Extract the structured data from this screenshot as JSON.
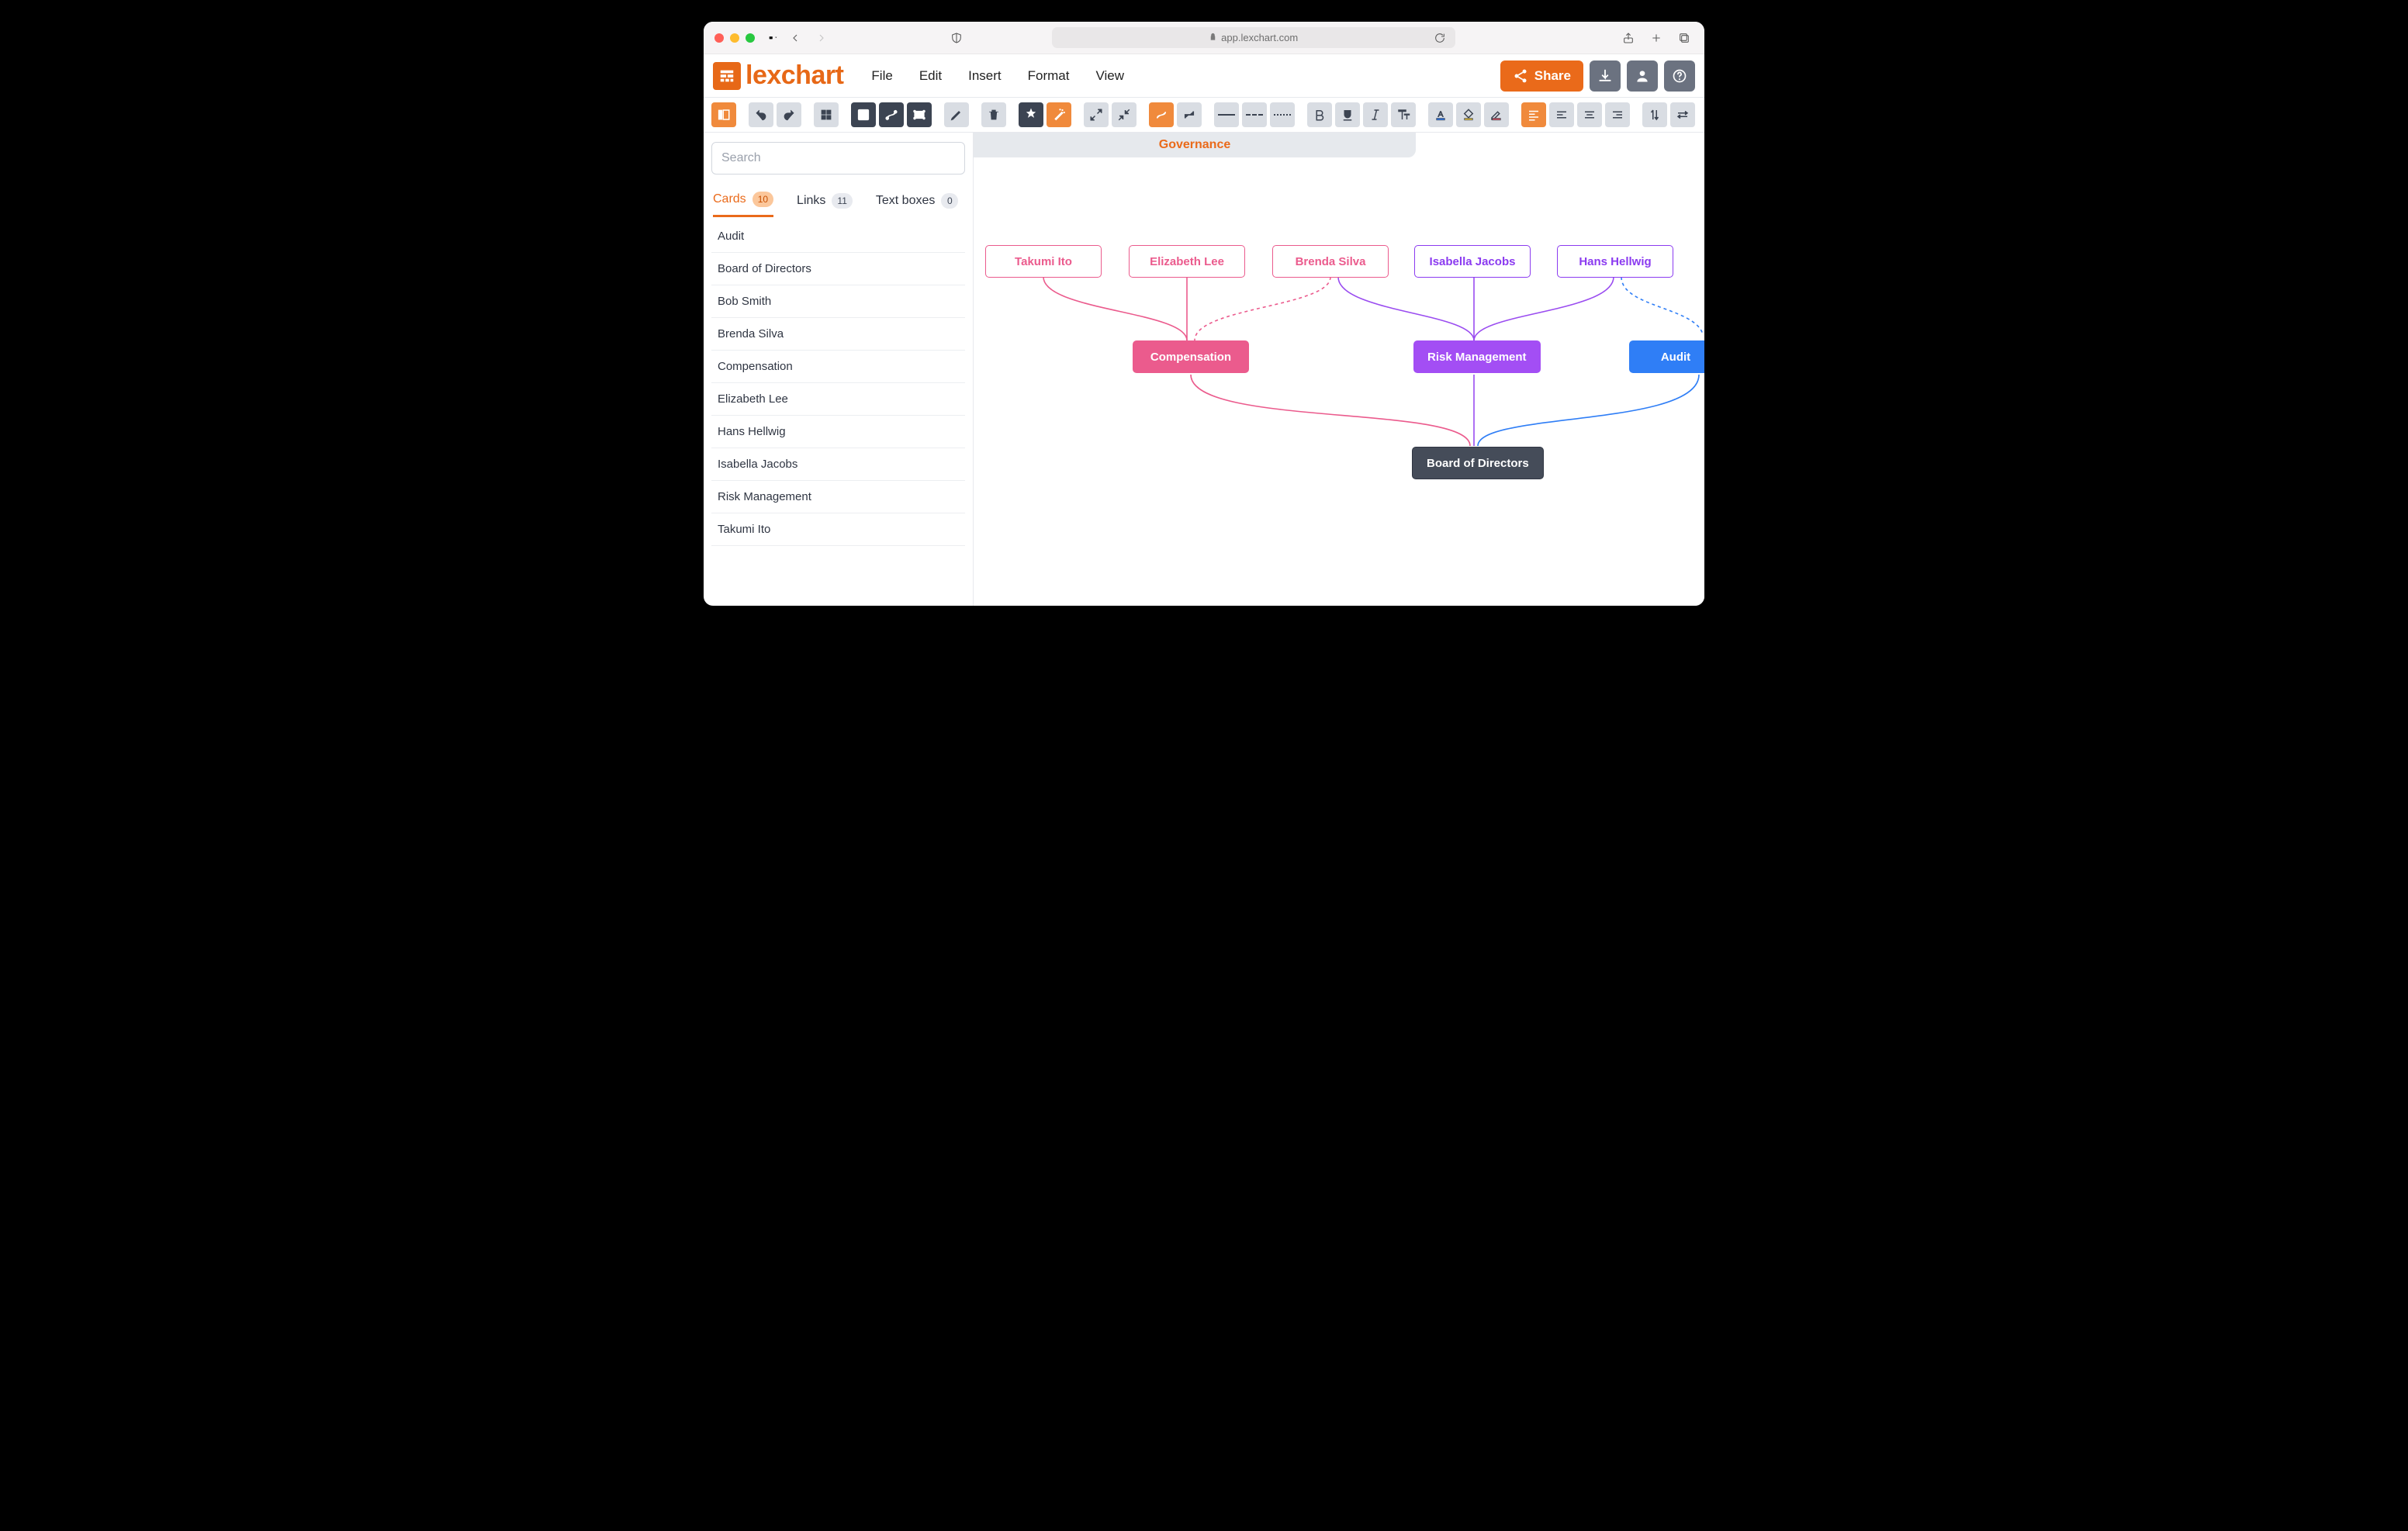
{
  "browser": {
    "url": "app.lexchart.com"
  },
  "app": {
    "brand": "lexchart",
    "menu": {
      "file": "File",
      "edit": "Edit",
      "insert": "Insert",
      "format": "Format",
      "view": "View"
    },
    "share_label": "Share"
  },
  "sidebar": {
    "search_placeholder": "Search",
    "tabs": {
      "cards": {
        "label": "Cards",
        "count": "10"
      },
      "links": {
        "label": "Links",
        "count": "11"
      },
      "textboxes": {
        "label": "Text boxes",
        "count": "0"
      }
    },
    "items": [
      "Audit",
      "Board of Directors",
      "Bob Smith",
      "Brenda Silva",
      "Compensation",
      "Elizabeth Lee",
      "Hans Hellwig",
      "Isabella Jacobs",
      "Risk Management",
      "Takumi Ito"
    ]
  },
  "canvas": {
    "tab_title": "Governance",
    "nodes": {
      "takumi": "Takumi Ito",
      "elizabeth": "Elizabeth Lee",
      "brenda": "Brenda Silva",
      "isabella": "Isabella Jacobs",
      "hans": "Hans Hellwig",
      "comp": "Compensation",
      "risk": "Risk Management",
      "audit": "Audit",
      "board": "Board of Directors"
    }
  },
  "colors": {
    "orange": "#ea6a1a",
    "pink": "#eb5b8d",
    "purple": "#9a4cf0",
    "violet": "#8b3bf0",
    "blue": "#2f7ef6",
    "slate": "#3c4452",
    "node_bg_pink": "#eb5b8d",
    "node_bg_purple": "#a34ef4",
    "node_bg_blue": "#2f7ef6",
    "node_bg_slate": "#454c59"
  }
}
